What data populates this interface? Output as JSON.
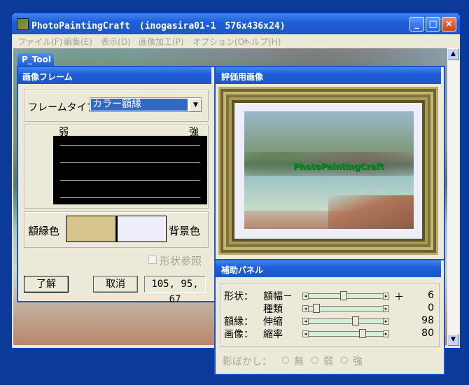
{
  "main_window": {
    "title": "PhotoPaintingCraft　(inogasira01-1　576x436x24)",
    "menu": [
      "ファイル(F)",
      "編集(E)",
      "表示(D)",
      "画像加工(P)",
      "オプション(O)",
      "ヘルプ(H)"
    ]
  },
  "ptool_tab": {
    "label": "P_Tool"
  },
  "frame_dialog": {
    "title": "画像フレーム",
    "frame_type_label": "フレームタイプ：",
    "frame_type_value": "カラー額縁",
    "weak_label": "弱",
    "strong_label": "強",
    "frame_color_label": "額縁色",
    "bg_color_label": "背景色",
    "frame_color": "#d7c68b",
    "bg_color": "#eeeefa",
    "shape_ref_label": "形状参照",
    "ok_label": "了解",
    "cancel_label": "取消",
    "color_value": "105, 95, 67"
  },
  "preview_window": {
    "title": "評価用画像",
    "watermark": "PhotoPaintingCraft"
  },
  "aux_panel": {
    "title": "補助パネル",
    "rows": [
      {
        "group": "形状：",
        "label": "額幅－",
        "value": "6",
        "level": 0.48,
        "plus": "＋"
      },
      {
        "group": "",
        "label": "種類",
        "value": "0",
        "level": 0.12,
        "plus": ""
      },
      {
        "group": "額縁：",
        "label": "伸縮",
        "value": "98",
        "level": 0.62,
        "plus": ""
      },
      {
        "group": "画像：",
        "label": "縮率",
        "value": "80",
        "level": 0.7,
        "plus": ""
      }
    ],
    "blur_label": "影ぼかし：",
    "blur_options": [
      "無",
      "弱",
      "強"
    ]
  }
}
